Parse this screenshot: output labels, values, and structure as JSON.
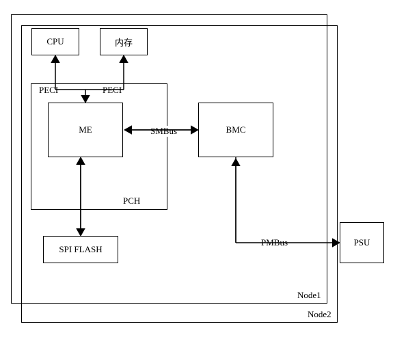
{
  "node2": {
    "label": "Node2"
  },
  "node1": {
    "label": "Node1"
  },
  "cpu": {
    "label": "CPU"
  },
  "mem": {
    "label": "内存"
  },
  "pch": {
    "label": "PCH"
  },
  "me": {
    "label": "ME"
  },
  "bmc": {
    "label": "BMC"
  },
  "spi": {
    "label": "SPI FLASH"
  },
  "psu": {
    "label": "PSU"
  },
  "bus": {
    "peci1": "PECI",
    "peci2": "PECI",
    "smbus": "SMBus",
    "pmbus": "PMBus"
  }
}
